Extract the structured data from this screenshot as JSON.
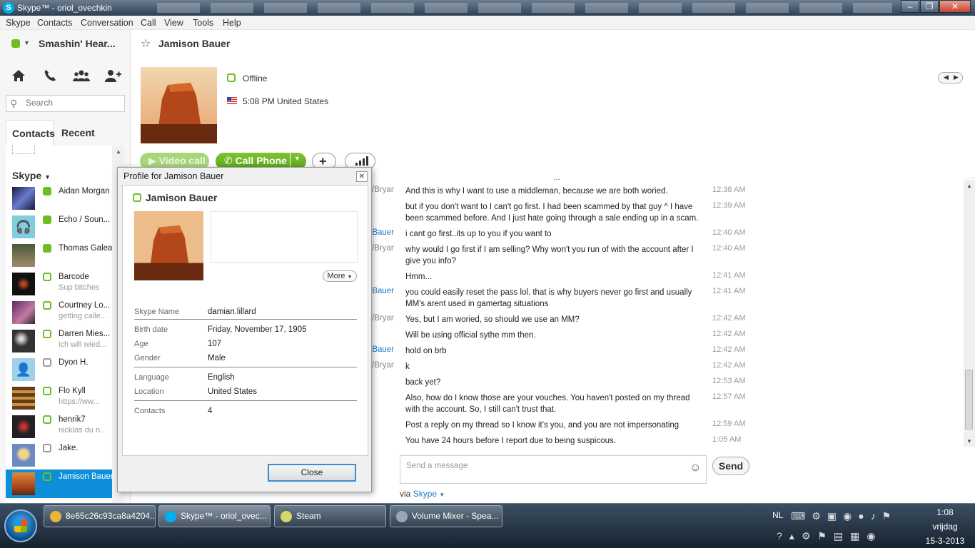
{
  "window": {
    "title": "Skype™ - oriol_ovechkin"
  },
  "menu": [
    "Skype",
    "Contacts",
    "Conversation",
    "Call",
    "View",
    "Tools",
    "Help"
  ],
  "user": {
    "display_name": "Smashin' Hear..."
  },
  "search": {
    "placeholder": "Search"
  },
  "tabs": {
    "contacts": "Contacts",
    "recent": "Recent"
  },
  "contact_group": "Skype",
  "contacts": [
    {
      "name": "Aidan Morgan",
      "mood": "",
      "status": "online"
    },
    {
      "name": "Echo / Soun...",
      "mood": "",
      "status": "online"
    },
    {
      "name": "Thomas Galea",
      "mood": "",
      "status": "online"
    },
    {
      "name": "Barcode",
      "mood": "Sup bitches",
      "status": "offline"
    },
    {
      "name": "Courtney Lo...",
      "mood": "getting calle...",
      "status": "offline"
    },
    {
      "name": "Darren Mies...",
      "mood": "ich will wied...",
      "status": "offline"
    },
    {
      "name": "Dyon H.",
      "mood": "",
      "status": "unknown"
    },
    {
      "name": "Flo Kyll",
      "mood": "https://ww...",
      "status": "offline"
    },
    {
      "name": "henrik7",
      "mood": "nicklas du n...",
      "status": "offline"
    },
    {
      "name": "Jake.",
      "mood": "",
      "status": "unknown"
    },
    {
      "name": "Jamison Bauer",
      "mood": "",
      "status": "offline"
    }
  ],
  "conversation": {
    "contact_name": "Jamison Bauer",
    "presence": "Offline",
    "local_time": "5:08 PM United States",
    "buttons": {
      "video_call": "Video call",
      "call_phone": "Call Phone"
    }
  },
  "messages": [
    {
      "sender": "/Bryan",
      "text": "And this is why I want to use a middleman, because we are both woried.",
      "time": "12:38 AM",
      "me": false
    },
    {
      "sender": "",
      "text": "but if you don't want to I can't go first. I had been scammed by that guy ^ I have been scammed before. And I just hate going through a sale ending up in a scam.",
      "time": "12:39 AM",
      "me": false
    },
    {
      "sender": "Bauer",
      "text": "i cant go first..its up to you if you want to",
      "time": "12:40 AM",
      "me": true
    },
    {
      "sender": "/Bryan",
      "text": "why would I go first if I am selling? Why won't you run of with the account after I give you info?",
      "time": "12:40 AM",
      "me": false
    },
    {
      "sender": "",
      "text": "Hmm...",
      "time": "12:41 AM",
      "me": false
    },
    {
      "sender": "Bauer",
      "text": "you could easily reset the pass lol. that is why buyers never go first and usually MM's arent used in gamertag situations",
      "time": "12:41 AM",
      "me": true
    },
    {
      "sender": "/Bryan",
      "text": "Yes, but I am woried, so should we use an MM?",
      "time": "12:42 AM",
      "me": false
    },
    {
      "sender": "",
      "text": "Will be using official sythe mm then.",
      "time": "12:42 AM",
      "me": false
    },
    {
      "sender": "Bauer",
      "text": "hold on brb",
      "time": "12:42 AM",
      "me": true
    },
    {
      "sender": "/Bryan",
      "text": "k",
      "time": "12:42 AM",
      "me": false
    },
    {
      "sender": "",
      "text": "back yet?",
      "time": "12:53 AM",
      "me": false
    },
    {
      "sender": "",
      "text": "Also, how do I know those are your vouches. You haven't posted on my thread with the account. So, I still can't trust that.",
      "time": "12:57 AM",
      "me": false
    },
    {
      "sender": "",
      "text": "Post a reply on my thread so I know it's you, and you are not impersonating",
      "time": "12:59 AM",
      "me": false
    },
    {
      "sender": "",
      "text": "You have 24 hours before I report due to being suspicous.",
      "time": "1:05 AM",
      "me": false
    }
  ],
  "compose": {
    "placeholder": "Send a message",
    "send": "Send",
    "via_prefix": "via",
    "via_service": "Skype"
  },
  "profile_dialog": {
    "title": "Profile for Jamison Bauer",
    "name": "Jamison Bauer",
    "more": "More",
    "fields": [
      {
        "label": "Skype Name",
        "value": "damian.lillard"
      },
      {
        "label": "Birth date",
        "value": "Friday, November 17, 1905"
      },
      {
        "label": "Age",
        "value": "107"
      },
      {
        "label": "Gender",
        "value": "Male"
      },
      {
        "label": "Language",
        "value": "English"
      },
      {
        "label": "Location",
        "value": "United States"
      },
      {
        "label": "Contacts",
        "value": "4"
      }
    ],
    "close": "Close"
  },
  "taskbar": {
    "items": [
      {
        "label": "8e65c26c93ca8a4204...",
        "color": "#e8b43a"
      },
      {
        "label": "Skype™ - oriol_ovec...",
        "color": "#00aff0"
      },
      {
        "label": "Steam",
        "color": "#d6d66a"
      },
      {
        "label": "Volume Mixer - Spea...",
        "color": "#9aa8b6"
      }
    ],
    "language": "NL",
    "clock": {
      "time": "1:08",
      "day": "vrijdag",
      "date": "15-3-2013"
    }
  },
  "colors": {
    "skype_green": "#6fbd1f",
    "skype_blue": "#00aff0",
    "selected": "#0c8fd8",
    "link": "#1e7bc7"
  }
}
